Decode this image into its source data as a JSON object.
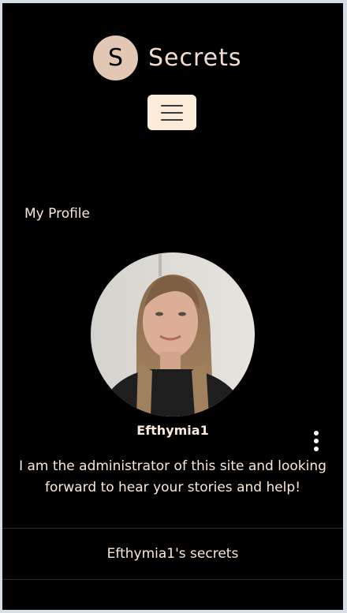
{
  "header": {
    "logo_letter": "S",
    "brand_name": "Secrets"
  },
  "colors": {
    "background": "#000000",
    "accent": "#e2c7b5",
    "menu_button": "#fbebd8",
    "text": "#fbe8d8"
  },
  "profile": {
    "section_title": "My Profile",
    "username": "Efthymia1",
    "bio": "I am the administrator of this site and looking forward to hear your stories and help!",
    "secrets_link": "Efthymia1's secrets"
  }
}
